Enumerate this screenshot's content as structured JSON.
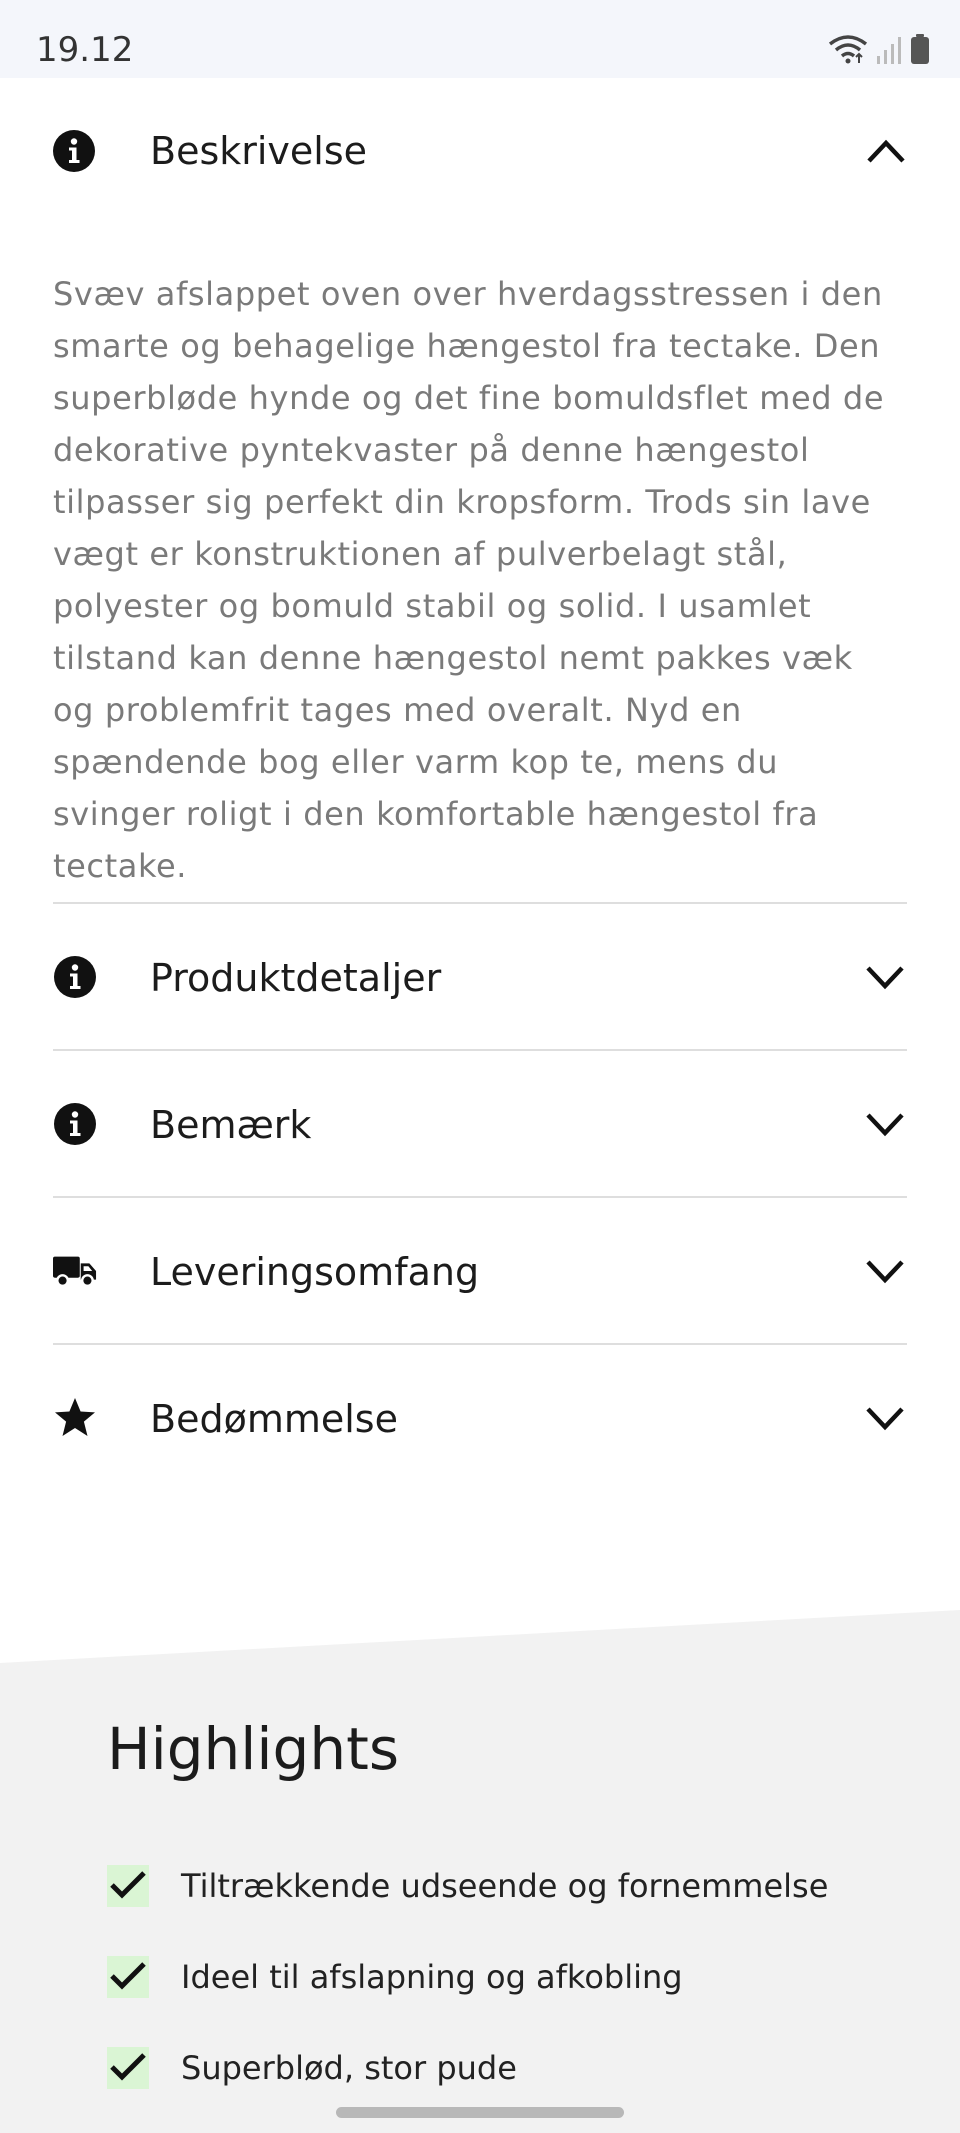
{
  "status_bar": {
    "time": "19.12",
    "icons": [
      "wifi-icon",
      "signal-icon",
      "battery-icon"
    ]
  },
  "description_section": {
    "title": "Beskrivelse",
    "icon": "info-icon",
    "expanded": true,
    "text": "Svæv afslappet oven over hverdagsstressen i den smarte og behagelige hængestol fra tectake. Den superbløde hynde og det fine bomuldsflet med de dekorative pyntekvaster på denne hængestol tilpasser sig perfekt din kropsform. Trods sin lave vægt er konstruktionen af pulverbelagt stål, polyester og bomuld stabil og solid. I usamlet tilstand kan denne hængestol nemt pakkes væk og problemfrit tages med overalt. Nyd en spændende bog eller varm kop te, mens du svinger roligt i den komfortable hængestol fra tectake."
  },
  "accordion": [
    {
      "label": "Produktdetaljer",
      "icon": "info-icon"
    },
    {
      "label": "Bemærk",
      "icon": "info-icon"
    },
    {
      "label": "Leveringsomfang",
      "icon": "truck-icon"
    },
    {
      "label": "Bedømmelse",
      "icon": "star-icon"
    }
  ],
  "highlights": {
    "title": "Highlights",
    "items": [
      "Tiltrækkende udseende og fornemmelse",
      "Ideel til afslapning og afkobling",
      "Superblød, stor pude"
    ]
  },
  "colors": {
    "status_bar_bg": "#f4f6fb",
    "text_primary": "#1c1c1c",
    "text_description": "#7a7a7a",
    "divider": "#dedede",
    "highlights_bg": "#f2f2f2",
    "check_bg": "#daf5d4"
  }
}
